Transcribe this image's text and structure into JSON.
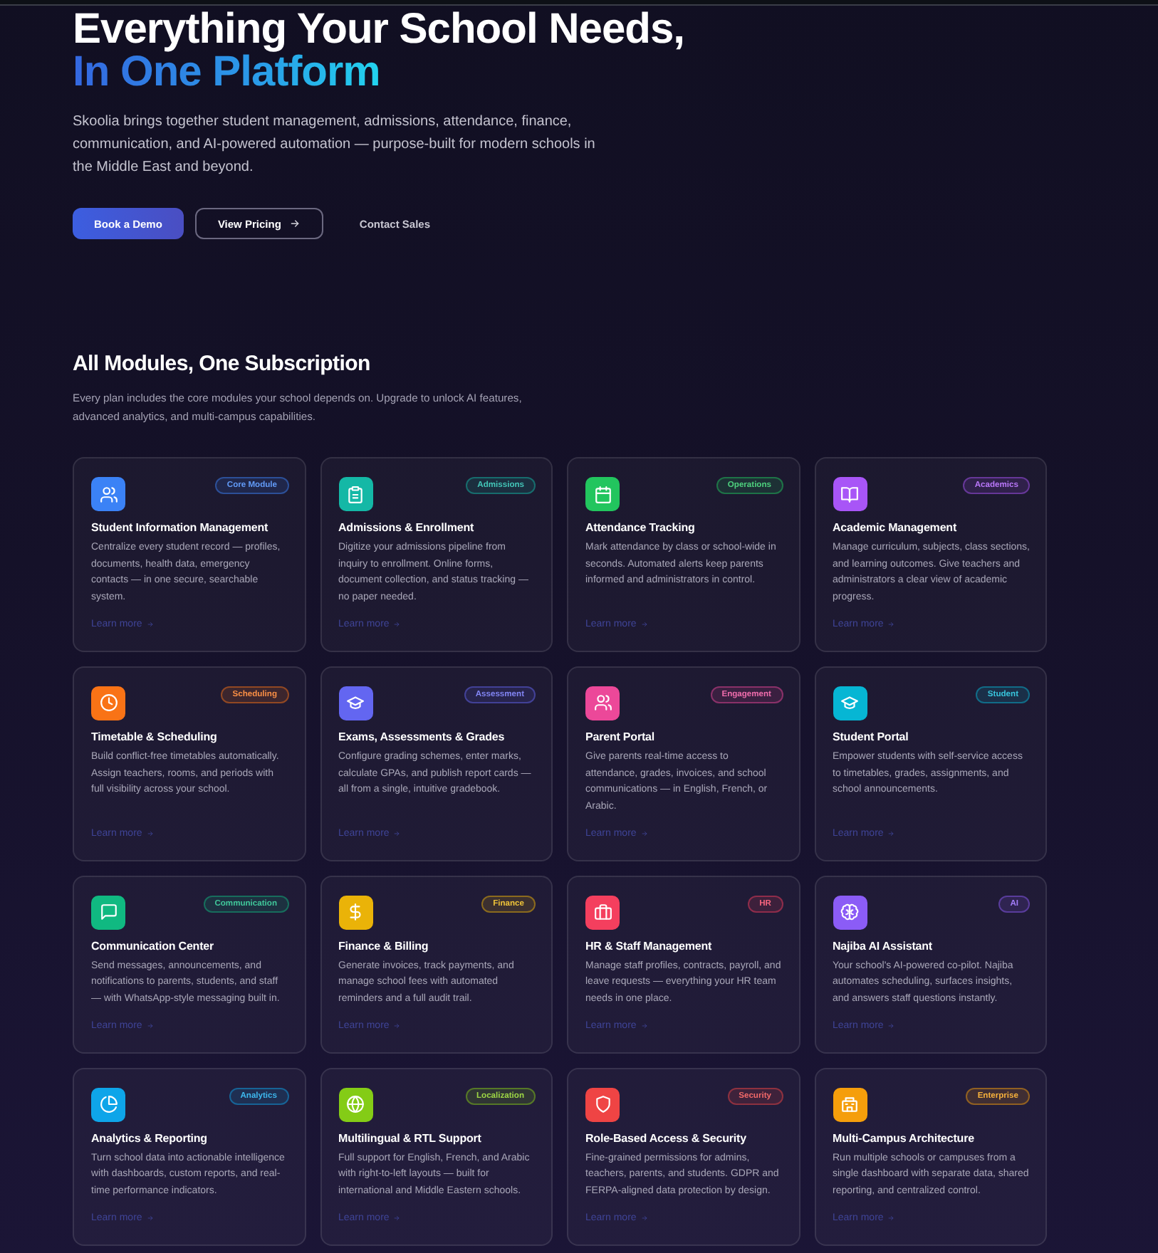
{
  "hero": {
    "title": "Everything Your School Needs,",
    "title_highlight": "In One Platform",
    "description": "Skoolia brings together student management, admissions, attendance, finance, communication, and AI-powered automation — purpose-built for modern schools in the Middle East and beyond.",
    "buttons": [
      {
        "label": "Book a Demo",
        "kind": "primary"
      },
      {
        "label": "View Pricing",
        "kind": "outline"
      },
      {
        "label": "Contact Sales",
        "kind": "text"
      }
    ]
  },
  "modules": {
    "heading": "All Modules, One Subscription",
    "description": "Every plan includes the core modules your school depends on. Upgrade to unlock AI features, advanced analytics, and multi-campus capabilities.",
    "cards": [
      {
        "title": "Student Information Management",
        "badge": "Core Module",
        "description": "Centralize every student record — profiles, documents, health data, emergency contacts — in one secure, searchable system.",
        "link": "Learn more",
        "color": "#3b82f6"
      },
      {
        "title": "Admissions & Enrollment",
        "badge": "Admissions",
        "description": "Digitize your admissions pipeline from inquiry to enrollment. Online forms, document collection, and status tracking — no paper needed.",
        "link": "Learn more",
        "color": "#14b8a6"
      },
      {
        "title": "Attendance Tracking",
        "badge": "Operations",
        "description": "Mark attendance by class or school-wide in seconds. Automated alerts keep parents informed and administrators in control.",
        "link": "Learn more",
        "color": "#22c55e"
      },
      {
        "title": "Academic Management",
        "badge": "Academics",
        "description": "Manage curriculum, subjects, class sections, and learning outcomes. Give teachers and administrators a clear view of academic progress.",
        "link": "Learn more",
        "color": "#a855f7"
      },
      {
        "title": "Timetable & Scheduling",
        "badge": "Scheduling",
        "description": "Build conflict-free timetables automatically. Assign teachers, rooms, and periods with full visibility across your school.",
        "link": "Learn more",
        "color": "#f97316"
      },
      {
        "title": "Exams, Assessments & Grades",
        "badge": "Assessment",
        "description": "Configure grading schemes, enter marks, calculate GPAs, and publish report cards — all from a single, intuitive gradebook.",
        "link": "Learn more",
        "color": "#6366f1"
      },
      {
        "title": "Parent Portal",
        "badge": "Engagement",
        "description": "Give parents real-time access to attendance, grades, invoices, and school communications — in English, French, or Arabic.",
        "link": "Learn more",
        "color": "#ec4899"
      },
      {
        "title": "Student Portal",
        "badge": "Student",
        "description": "Empower students with self-service access to timetables, grades, assignments, and school announcements.",
        "link": "Learn more",
        "color": "#06b6d4"
      },
      {
        "title": "Communication Center",
        "badge": "Communication",
        "description": "Send messages, announcements, and notifications to parents, students, and staff — with WhatsApp-style messaging built in.",
        "link": "Learn more",
        "color": "#10b981"
      },
      {
        "title": "Finance & Billing",
        "badge": "Finance",
        "description": "Generate invoices, track payments, and manage school fees with automated reminders and a full audit trail.",
        "link": "Learn more",
        "color": "#eab308"
      },
      {
        "title": "HR & Staff Management",
        "badge": "HR",
        "description": "Manage staff profiles, contracts, payroll, and leave requests — everything your HR team needs in one place.",
        "link": "Learn more",
        "color": "#f43f5e"
      },
      {
        "title": "Najiba AI Assistant",
        "badge": "AI",
        "description": "Your school's AI-powered co-pilot. Najiba automates scheduling, surfaces insights, and answers staff questions instantly.",
        "link": "Learn more",
        "color": "#8b5cf6"
      },
      {
        "title": "Analytics & Reporting",
        "badge": "Analytics",
        "description": "Turn school data into actionable intelligence with dashboards, custom reports, and real-time performance indicators.",
        "link": "Learn more",
        "color": "#0ea5e9"
      },
      {
        "title": "Multilingual & RTL Support",
        "badge": "Localization",
        "description": "Full support for English, French, and Arabic with right-to-left layouts — built for international and Middle Eastern schools.",
        "link": "Learn more",
        "color": "#84cc16"
      },
      {
        "title": "Role-Based Access & Security",
        "badge": "Security",
        "description": "Fine-grained permissions for admins, teachers, parents, and students. GDPR and FERPA-aligned data protection by design.",
        "link": "Learn more",
        "color": "#ef4444"
      },
      {
        "title": "Multi-Campus Architecture",
        "badge": "Enterprise",
        "description": "Run multiple schools or campuses from a single dashboard with separate data, shared reporting, and centralized control.",
        "link": "Learn more",
        "color": "#f59e0b"
      }
    ]
  }
}
